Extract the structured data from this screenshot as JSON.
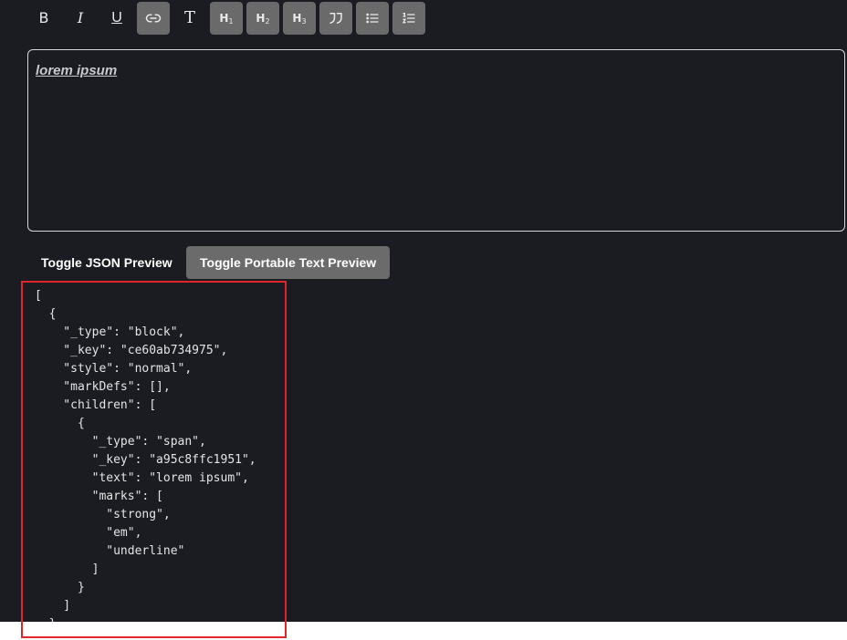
{
  "toolbar": {
    "buttons": [
      {
        "name": "bold",
        "label": "B",
        "icon": "bold-icon"
      },
      {
        "name": "italic",
        "label": "I",
        "icon": "italic-icon"
      },
      {
        "name": "underline",
        "label": "U",
        "icon": "underline-icon"
      },
      {
        "name": "link",
        "icon": "link-icon"
      },
      {
        "name": "normal-text",
        "label": "T",
        "icon": "text-icon"
      },
      {
        "name": "h1",
        "label": "H",
        "sub": "1",
        "icon": "heading-1-icon"
      },
      {
        "name": "h2",
        "label": "H",
        "sub": "2",
        "icon": "heading-2-icon"
      },
      {
        "name": "h3",
        "label": "H",
        "sub": "3",
        "icon": "heading-3-icon"
      },
      {
        "name": "quote",
        "icon": "quote-icon"
      },
      {
        "name": "bullet-list",
        "icon": "bullet-list-icon"
      },
      {
        "name": "numbered-list",
        "icon": "numbered-list-icon"
      }
    ]
  },
  "editor": {
    "text": "lorem ipsum"
  },
  "buttons": {
    "json_preview": "Toggle JSON Preview",
    "portable_text_preview": "Toggle Portable Text Preview"
  },
  "json_preview": {
    "lines": [
      "[",
      "  {",
      "    \"_type\": \"block\",",
      "    \"_key\": \"ce60ab734975\",",
      "    \"style\": \"normal\",",
      "    \"markDefs\": [],",
      "    \"children\": [",
      "      {",
      "        \"_type\": \"span\",",
      "        \"_key\": \"a95c8ffc1951\",",
      "        \"text\": \"lorem ipsum\",",
      "        \"marks\": [",
      "          \"strong\",",
      "          \"em\",",
      "          \"underline\"",
      "        ]",
      "      }",
      "    ]",
      "  }"
    ]
  },
  "colors": {
    "background": "#1a1c22",
    "active_button": "#6a6a6a",
    "highlight": "#e0262a"
  }
}
